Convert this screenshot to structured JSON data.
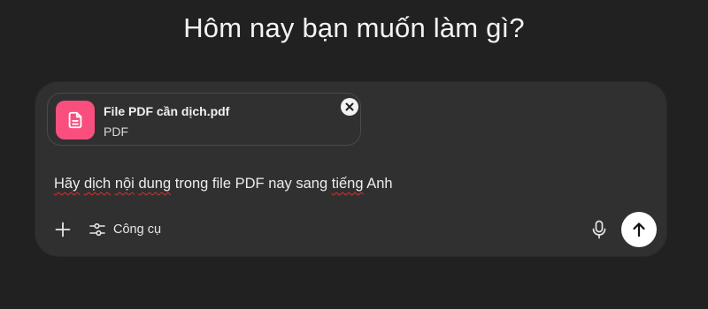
{
  "heading": "Hôm nay bạn muốn làm gì?",
  "attachment": {
    "file_name": "File PDF cần dịch.pdf",
    "file_type": "PDF",
    "icon": "document-icon",
    "icon_color": "#fa4f7e"
  },
  "prompt": {
    "parts": [
      "Hãy",
      " ",
      "dịch",
      " ",
      "nội",
      " ",
      "dung",
      " trong file PDF nay sang ",
      "tiếng",
      " Anh"
    ]
  },
  "toolbar": {
    "add_icon": "plus-icon",
    "tools_icon": "sliders-icon",
    "tools_label": "Công cụ",
    "mic_icon": "microphone-icon",
    "send_icon": "arrow-up-icon"
  },
  "colors": {
    "background": "#212121",
    "composer": "#303030",
    "accent": "#fa4f7e"
  }
}
